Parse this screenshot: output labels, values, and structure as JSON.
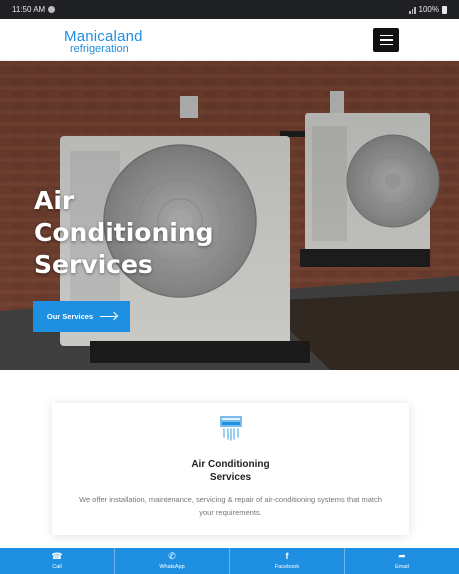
{
  "status_bar": {
    "time": "11:50 AM",
    "battery": "100%"
  },
  "header": {
    "logo_line1": "Manicaland",
    "logo_line2": "refrigeration",
    "menu_icon": "hamburger-icon"
  },
  "hero": {
    "title_line1": "Air",
    "title_line2": "Conditioning",
    "title_line3": "Services",
    "button_label": "Our Services"
  },
  "service_card": {
    "icon": "air-conditioner-icon",
    "title_line1": "Air Conditioning",
    "title_line2": "Services",
    "description": "We offer installation, maintenance, servicing & repair of air-conditioning systems that match your requirements."
  },
  "bottom_bar": {
    "items": [
      {
        "label": "Call",
        "icon": "phone-icon"
      },
      {
        "label": "WhatsApp",
        "icon": "whatsapp-icon"
      },
      {
        "label": "Facebook",
        "icon": "facebook-icon"
      },
      {
        "label": "Email",
        "icon": "email-icon"
      }
    ]
  },
  "colors": {
    "accent": "#1e8fe1",
    "status_bar": "#202124",
    "card_title": "#222222",
    "card_text": "#777777"
  }
}
